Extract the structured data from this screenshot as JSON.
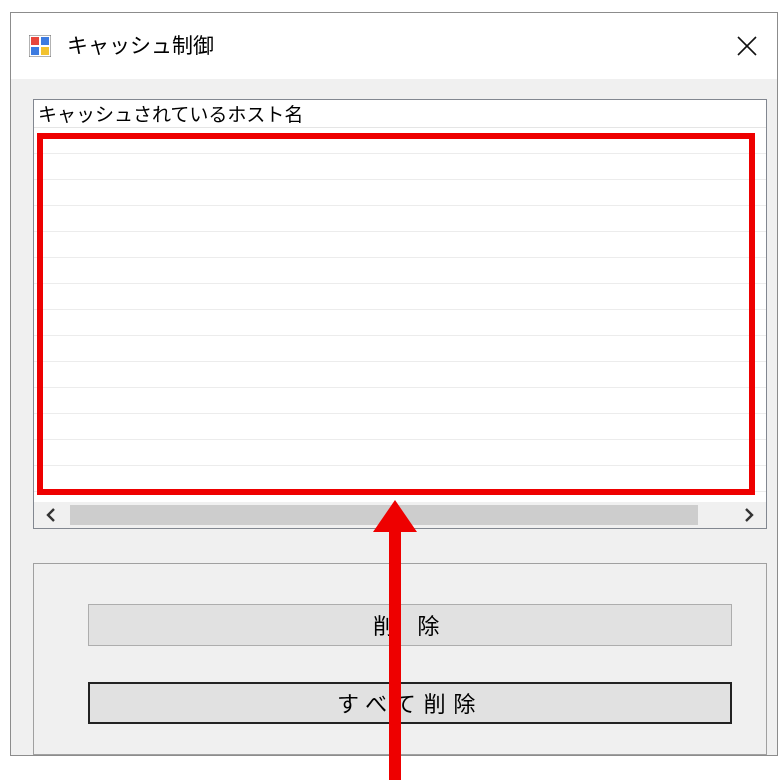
{
  "window": {
    "title": "キャッシュ制御"
  },
  "listview": {
    "column_header": "キャッシュされているホスト名",
    "rows": []
  },
  "buttons": {
    "delete_label": "削 除",
    "delete_all_label": "すべて削除"
  },
  "annotation": {
    "color": "#ee0000"
  }
}
